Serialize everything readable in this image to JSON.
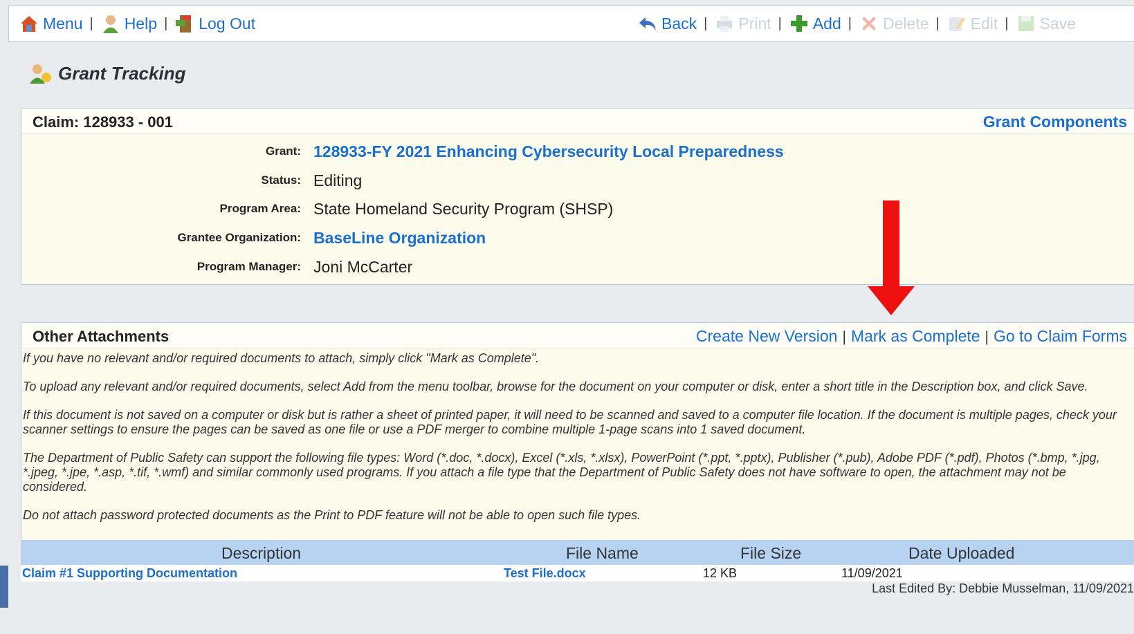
{
  "toolbar": {
    "left": [
      {
        "label": "Menu",
        "icon": "menu-icon"
      },
      {
        "label": "Help",
        "icon": "help-icon"
      },
      {
        "label": "Log Out",
        "icon": "logout-icon"
      }
    ],
    "right": [
      {
        "label": "Back",
        "icon": "back-icon",
        "enabled": true
      },
      {
        "label": "Print",
        "icon": "print-icon",
        "enabled": false
      },
      {
        "label": "Add",
        "icon": "add-icon",
        "enabled": true
      },
      {
        "label": "Delete",
        "icon": "delete-icon",
        "enabled": false
      },
      {
        "label": "Edit",
        "icon": "edit-icon",
        "enabled": false
      },
      {
        "label": "Save",
        "icon": "save-icon",
        "enabled": false
      }
    ]
  },
  "page_title": "Grant Tracking",
  "claim": {
    "header": "Claim: 128933 - 001",
    "components_link": "Grant Components",
    "fields": [
      {
        "label": "Grant:",
        "value": "128933-FY 2021 Enhancing Cybersecurity Local Preparedness",
        "link": true
      },
      {
        "label": "Status:",
        "value": "Editing",
        "link": false
      },
      {
        "label": "Program Area:",
        "value": "State Homeland Security Program (SHSP)",
        "link": false
      },
      {
        "label": "Grantee Organization:",
        "value": "BaseLine Organization",
        "link": true
      },
      {
        "label": "Program Manager:",
        "value": "Joni McCarter",
        "link": false
      }
    ]
  },
  "attachments": {
    "header": "Other Attachments",
    "links": [
      "Create New Version",
      "Mark as Complete",
      "Go to Claim Forms"
    ],
    "instructions": [
      "If you have no relevant and/or required documents to attach, simply click \"Mark as Complete\".",
      "To upload any relevant and/or required documents, select Add from the menu toolbar, browse for the document on your computer or disk, enter a short title in the Description box, and click Save.",
      "If this document is not saved on a computer or disk but is rather a sheet of printed paper, it will need to be scanned and saved to a computer file location. If the document is multiple pages, check your scanner settings to ensure the pages can be saved as one file or use a PDF merger to combine multiple 1-page scans into 1 saved document.",
      "The Department of Public Safety can support the following file types: Word (*.doc, *.docx), Excel (*.xls, *.xlsx), PowerPoint (*.ppt, *.pptx), Publisher (*.pub), Adobe PDF (*.pdf), Photos (*.bmp, *.jpg, *.jpeg, *.jpe, *.asp, *.tif, *.wmf) and similar commonly used programs. If you attach a file type that the Department of Public Safety does not have software to open, the attachment may not be considered.",
      "Do not attach password protected documents as the Print to PDF feature will not be able to open such file types."
    ],
    "columns": [
      "Description",
      "File Name",
      "File Size",
      "Date Uploaded"
    ],
    "rows": [
      {
        "description": "Claim #1 Supporting Documentation",
        "file_name": "Test File.docx",
        "file_size": "12 KB",
        "date_uploaded": "11/09/2021"
      }
    ],
    "last_edited": "Last Edited By: Debbie Musselman, 11/09/2021"
  },
  "colors": {
    "link": "#1b6fcf",
    "panel": "#fbfbeb",
    "table_header": "#b7d3f2",
    "arrow": "#ee1111"
  }
}
